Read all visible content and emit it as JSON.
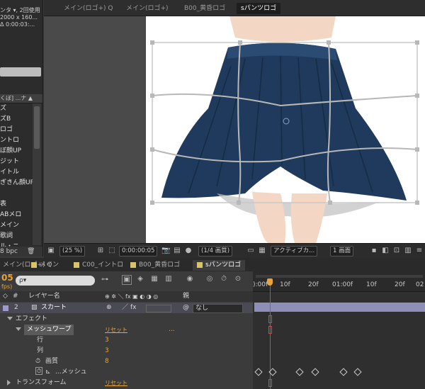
{
  "project": {
    "info_lines": [
      "ンタ ▾, 2回使用",
      "2000 x 160...",
      "Δ 0:00:03:..."
    ],
    "header": "くぼ]  ...ナ ▲",
    "items": [
      "ズ",
      "ズB",
      "ロゴ",
      "ントロ",
      "ぼ顔UP",
      "ジット",
      "イトル",
      "ぎきん顔UP",
      "",
      "表",
      "ABメロ",
      "メイン",
      "歌詞",
      "ル・ニ"
    ],
    "bpc": "8 bpc"
  },
  "viewer": {
    "tabs": [
      "メイン(ロゴ+) Q",
      "メイン(ロゴ+)",
      "B00_黄昏ロゴ",
      "sパンツロゴ"
    ],
    "active_tab": "sパンツロゴ",
    "zoom": "(25 %)",
    "timecode": "0:00:00:05",
    "resolution": "(1/4 画質)",
    "camera": "アクティブカ...",
    "views": "1 画面"
  },
  "timeline": {
    "tabs": [
      {
        "label": "メイン(ロゴ+) Q",
        "color": "#8a8a8a"
      },
      {
        "label": "メイン",
        "color": "#d8c56a"
      },
      {
        "label": "C00_イントロ",
        "color": "#d8c56a"
      },
      {
        "label": "B00_黄昏ロゴ",
        "color": "#d8c56a"
      },
      {
        "label": "sパンツロゴ",
        "color": "#d8c56a"
      }
    ],
    "time_display": "05",
    "fps": "fps)",
    "search_placeholder": "ρ▾",
    "col_layer_name": "レイヤー名",
    "col_parent": "親",
    "layer": {
      "num": "2",
      "name": "スカート",
      "parent": "なし"
    },
    "effects_label": "エフェクト",
    "mesh_warp": {
      "name": "メッシュワープ",
      "reset": "リセット",
      "extra": "..."
    },
    "rows_label": "行",
    "rows_value": "3",
    "cols_label": "列",
    "cols_value": "3",
    "quality_label": "画質",
    "quality_value": "8",
    "mesh_label": "...メッシュ",
    "transform_label": "トランスフォーム",
    "transform_reset": "リセット",
    "ruler": [
      "):00f",
      "10f",
      "20f",
      "01:00f",
      "10f",
      "20f",
      "02"
    ]
  },
  "colors": {
    "skirt": "#1f3a5c",
    "playhead": "#e8a33a",
    "warp_grid": "#b8b8b8"
  }
}
